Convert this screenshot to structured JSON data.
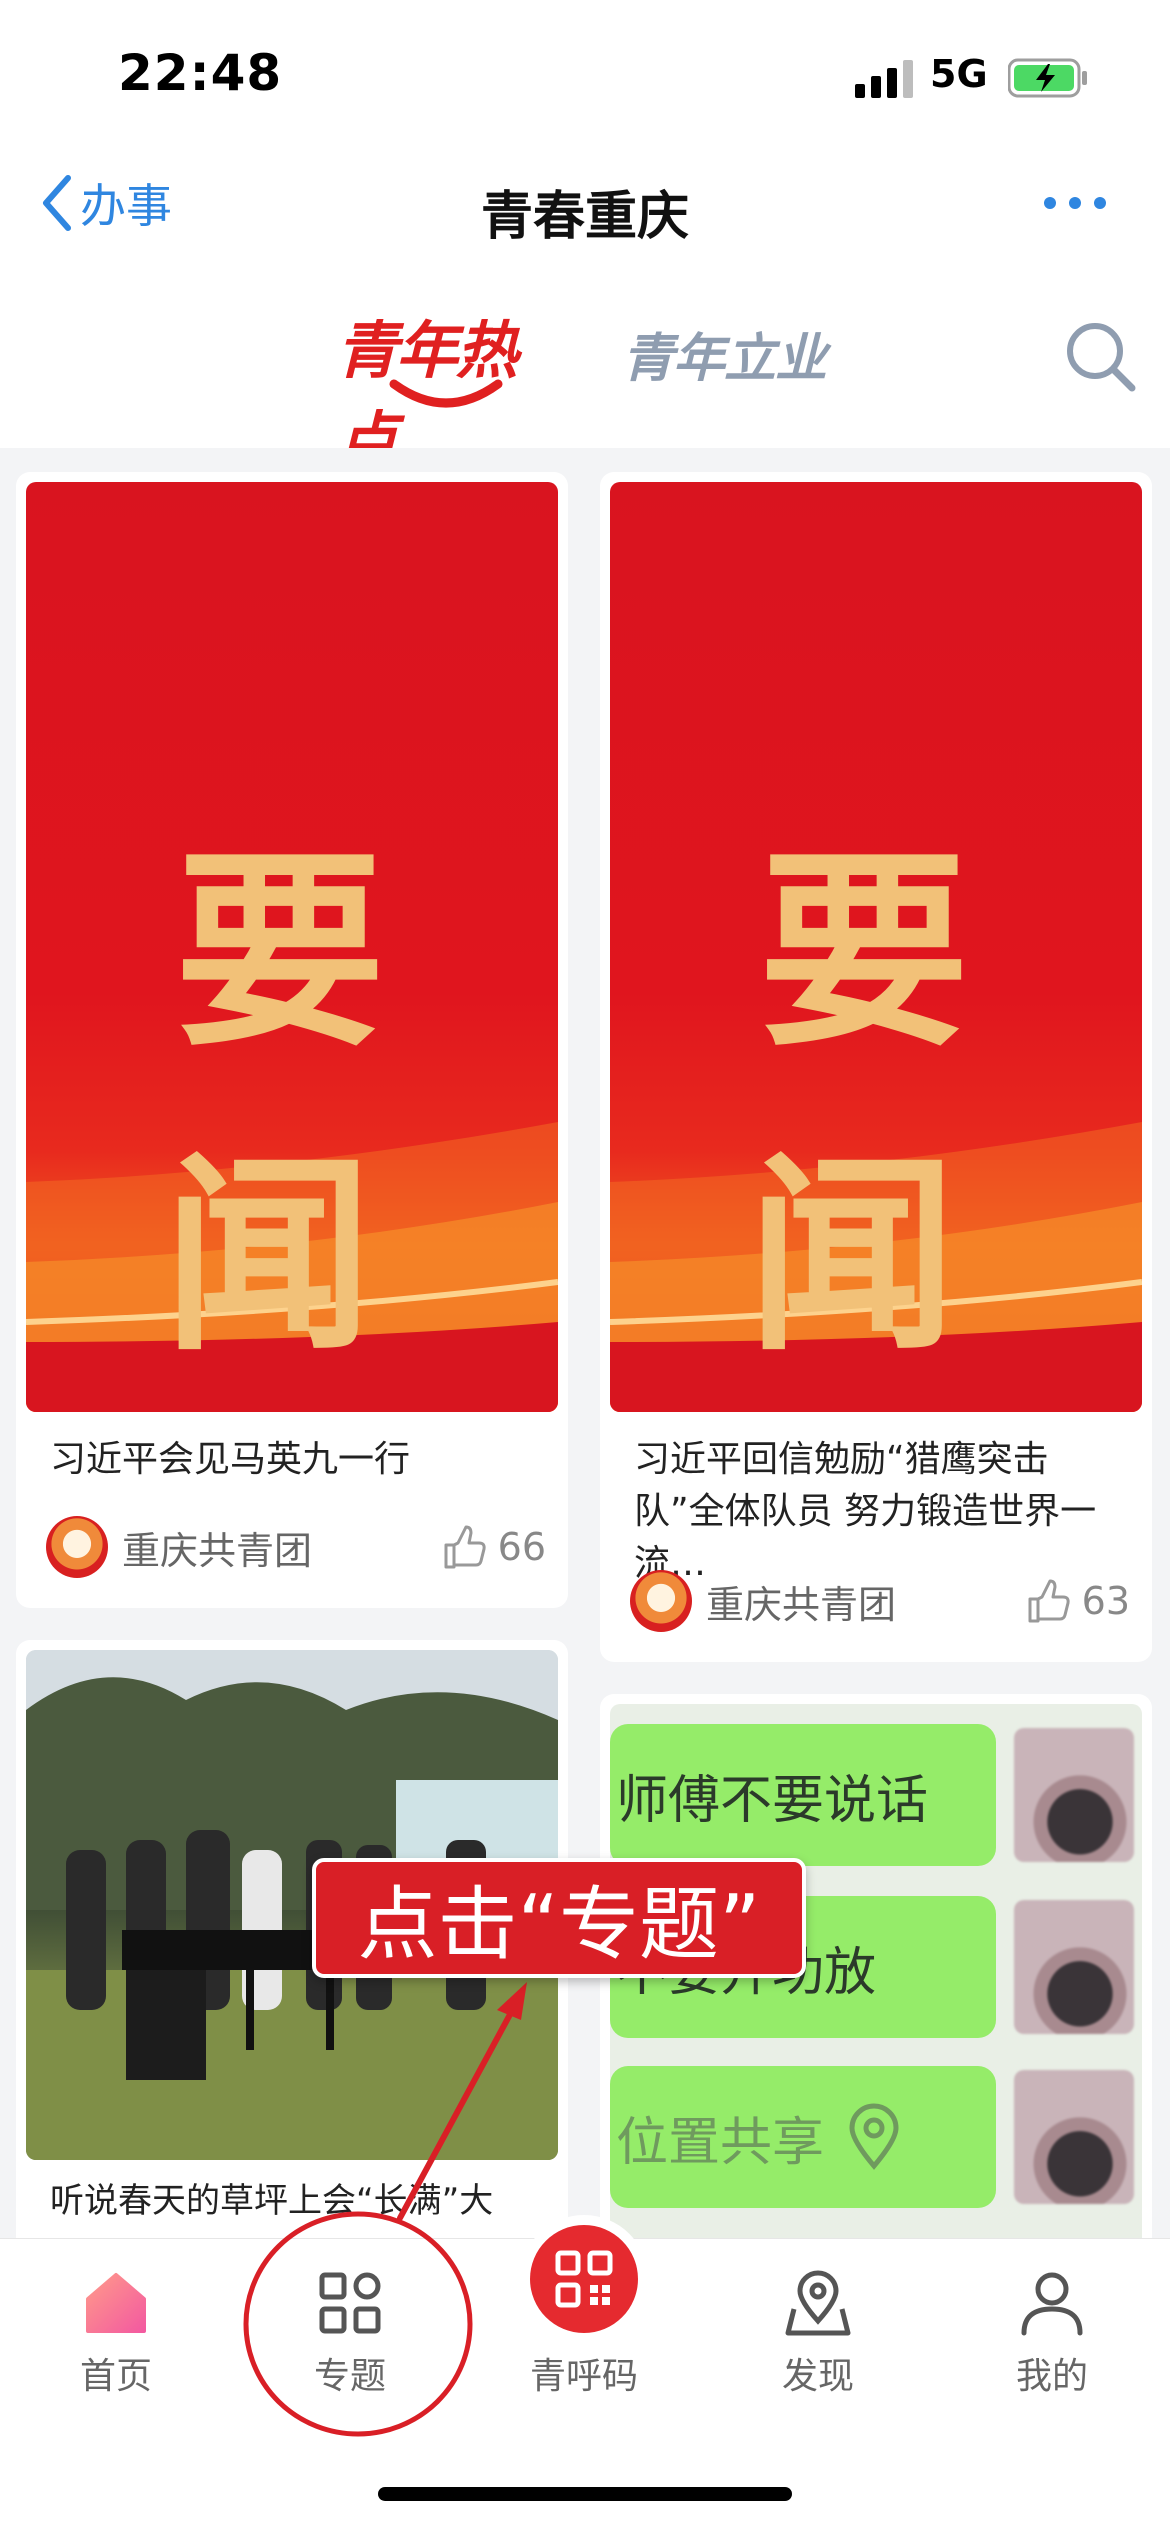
{
  "status_bar": {
    "time": "22:48",
    "network": "5G"
  },
  "nav": {
    "back_label": "办事",
    "title": "青春重庆"
  },
  "tabs": {
    "active": "青年热点",
    "inactive": "青年立业"
  },
  "feed": [
    {
      "cover_text": "要闻",
      "title": "习近平会见马英九一行",
      "author": "重庆共青团",
      "likes": "66"
    },
    {
      "cover_text": "要闻",
      "title": "习近平回信勉励“猎鹰突击队”全体队员 努力锻造世界一流…",
      "author": "重庆共青团",
      "likes": "63"
    },
    {
      "title": "听说春天的草坪上会“长满”大"
    },
    {
      "chat_lines": [
        "师傅不要说话",
        "不要开功放",
        "位置共享"
      ]
    }
  ],
  "hint": {
    "text": "点击“专题”"
  },
  "bottom_tabs": [
    {
      "label": "首页",
      "icon": "home-icon"
    },
    {
      "label": "专题",
      "icon": "grid-icon"
    },
    {
      "label": "青呼码",
      "icon": "qr-code-icon"
    },
    {
      "label": "发现",
      "icon": "map-pin-icon"
    },
    {
      "label": "我的",
      "icon": "person-icon"
    }
  ],
  "colors": {
    "accent_red": "#e02020",
    "link_blue": "#2f86e0",
    "tab_gray": "#8f9db0",
    "chat_green": "#95ec69"
  }
}
